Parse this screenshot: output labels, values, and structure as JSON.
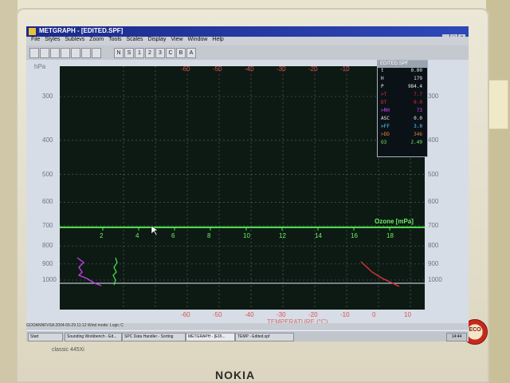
{
  "window": {
    "title": "METGRAPH - [EDITED.SPF]",
    "menu": [
      "File",
      "Styles",
      "Sublevs",
      "Zoom",
      "Tools",
      "Scales",
      "Display",
      "View",
      "Window",
      "Help"
    ],
    "toolbar_buttons": [
      "N",
      "S",
      "1",
      "2",
      "3",
      "C",
      "B",
      "A"
    ]
  },
  "plot": {
    "pressure_unit": "hPa",
    "pressure_ticks": [
      "300",
      "400",
      "500",
      "600",
      "700",
      "800",
      "900",
      "1000"
    ],
    "temperature_ticks_top": [
      "-60",
      "-50",
      "-40",
      "-30",
      "-20",
      "-10"
    ],
    "temperature_ticks_bottom": [
      "-60",
      "-50",
      "-40",
      "-30",
      "-20",
      "-10",
      "0",
      "10"
    ],
    "temperature_axis_title": "TEMPERATURE (°C)",
    "ozone_label": "Ozone [mPa]",
    "ozone_ticks": [
      "2",
      "4",
      "6",
      "8",
      "10",
      "12",
      "14",
      "16",
      "18"
    ],
    "colors": {
      "background": "#0d1a14",
      "grid": "#5a6a72",
      "ozone": "#53e84f",
      "temperature": "#e0303a",
      "humidity": "#c040e0",
      "accent_green": "#6ef062"
    }
  },
  "panel": {
    "title": "EDITED.SPF",
    "rows": [
      {
        "k": "t",
        "v": "0.00",
        "color": "#e8e8e8"
      },
      {
        "k": "H",
        "v": "179",
        "color": "#e8e8e8"
      },
      {
        "k": "P",
        "v": "984.4",
        "color": "#e8e8e8"
      },
      {
        "k": ">T",
        "v": "7.7",
        "color": "#e03030"
      },
      {
        "k": "DT",
        "v": "0.0",
        "color": "#e03030"
      },
      {
        "k": ">RH",
        "v": "73",
        "color": "#d050ff"
      },
      {
        "k": "ASC",
        "v": "0.0",
        "color": "#e8e8e8"
      },
      {
        "k": ">FF",
        "v": "3.0",
        "color": "#60d0ff"
      },
      {
        "k": ">DD",
        "v": "346",
        "color": "#e08030"
      },
      {
        "k": "O3",
        "v": "2.49",
        "color": "#6ef062"
      }
    ]
  },
  "statusbar": {
    "text": "GOOANNFVSA 2004-05-29 11:12    Wind mode: Logic C"
  },
  "taskbar": {
    "items": [
      "Start",
      "Sounding Workbench - Ed...",
      "SPC Data Handler - Sorting",
      "METGRAPH - [EDI...",
      "TEMP - Edited.spf"
    ],
    "clock": "14:44"
  },
  "monitor": {
    "brand": "NOKIA",
    "model": "classic 445Xi",
    "sticker": "ECO"
  }
}
